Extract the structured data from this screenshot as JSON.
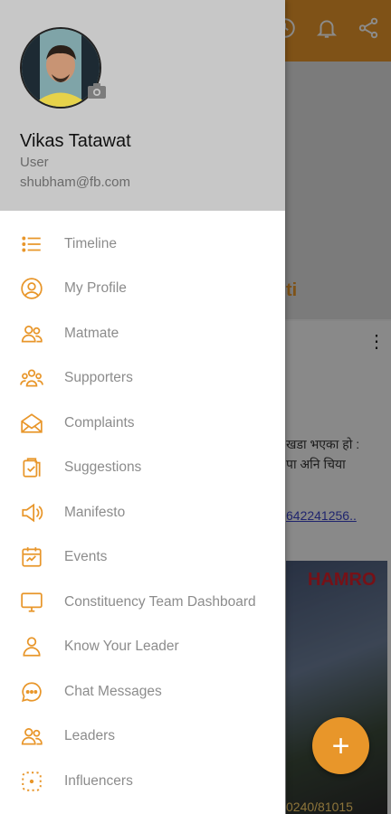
{
  "background": {
    "title_fragment": "ti",
    "post_text_line1": "खडा भएका हो :",
    "post_text_line2": "पा अनि चिया",
    "post_link": "642241256..",
    "image_banner": "HAMRO",
    "image_footer": "0240/81015",
    "fab_label": "+"
  },
  "profile": {
    "name": "Vikas  Tatawat",
    "role": "User",
    "email": "shubham@fb.com"
  },
  "menu": [
    {
      "label": "Timeline",
      "icon": "list-icon"
    },
    {
      "label": "My Profile",
      "icon": "user-circle-icon"
    },
    {
      "label": "Matmate",
      "icon": "users-icon"
    },
    {
      "label": "Supporters",
      "icon": "group-icon"
    },
    {
      "label": "Complaints",
      "icon": "envelope-open-icon"
    },
    {
      "label": "Suggestions",
      "icon": "clipboard-check-icon"
    },
    {
      "label": "Manifesto",
      "icon": "megaphone-icon"
    },
    {
      "label": "Events",
      "icon": "calendar-icon"
    },
    {
      "label": "Constituency Team Dashboard",
      "icon": "monitor-icon"
    },
    {
      "label": "Know Your Leader",
      "icon": "person-icon"
    },
    {
      "label": "Chat Messages",
      "icon": "chat-bubble-icon"
    },
    {
      "label": "Leaders",
      "icon": "users-icon"
    },
    {
      "label": "Influencers",
      "icon": "dotted-frame-icon"
    }
  ],
  "colors": {
    "accent": "#e8962a",
    "drawer_header": "#c7c7c7",
    "menu_text": "#8c8c8c"
  }
}
